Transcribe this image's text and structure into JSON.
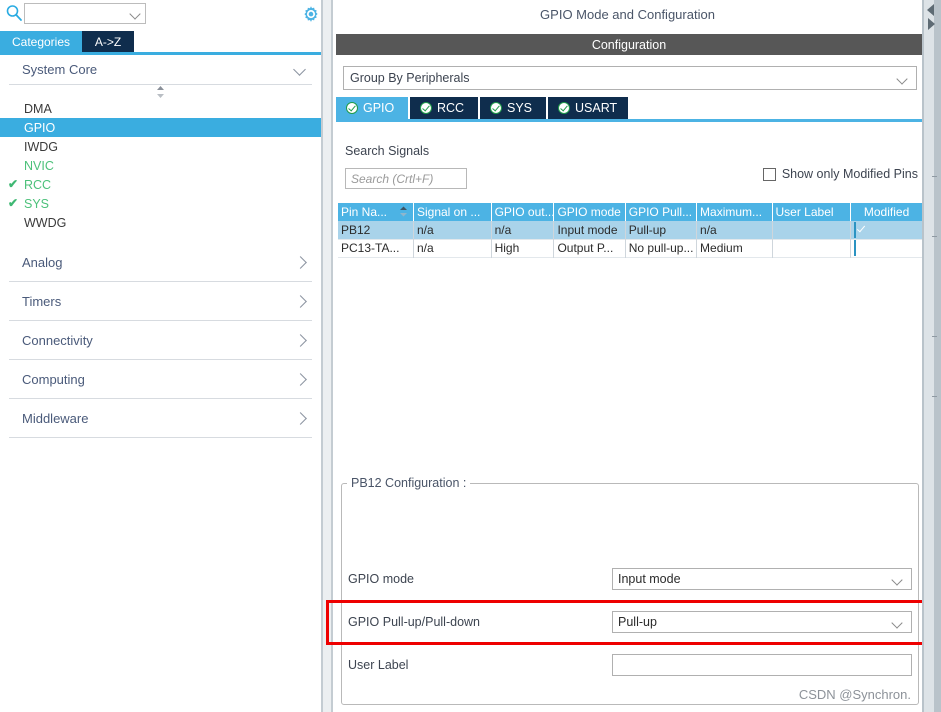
{
  "sidebar": {
    "search": {
      "value": "",
      "placeholder": "",
      "icon": "search-icon"
    },
    "gear_icon": "gear-icon",
    "tabs": [
      {
        "label": "Categories",
        "active": true
      },
      {
        "label": "A->Z",
        "active": false
      }
    ],
    "groups": [
      {
        "label": "System Core",
        "expanded": true,
        "items": [
          {
            "label": "DMA",
            "state": "normal",
            "selected": false
          },
          {
            "label": "GPIO",
            "state": "normal",
            "selected": true
          },
          {
            "label": "IWDG",
            "state": "normal",
            "selected": false
          },
          {
            "label": "NVIC",
            "state": "green",
            "selected": false
          },
          {
            "label": "RCC",
            "state": "checked",
            "selected": false
          },
          {
            "label": "SYS",
            "state": "checked",
            "selected": false
          },
          {
            "label": "WWDG",
            "state": "normal",
            "selected": false
          }
        ]
      },
      {
        "label": "Analog",
        "expanded": false,
        "items": []
      },
      {
        "label": "Timers",
        "expanded": false,
        "items": []
      },
      {
        "label": "Connectivity",
        "expanded": false,
        "items": []
      },
      {
        "label": "Computing",
        "expanded": false,
        "items": []
      },
      {
        "label": "Middleware",
        "expanded": false,
        "items": []
      }
    ]
  },
  "panel": {
    "title": "GPIO Mode and Configuration",
    "configuration_bar": "Configuration",
    "group_by": {
      "value": "Group By Peripherals"
    },
    "peripheral_tabs": [
      {
        "label": "GPIO",
        "status": "ok",
        "active": true
      },
      {
        "label": "RCC",
        "status": "ok",
        "active": false
      },
      {
        "label": "SYS",
        "status": "ok",
        "active": false
      },
      {
        "label": "USART",
        "status": "ok",
        "active": false
      }
    ],
    "search_signals_label": "Search Signals",
    "signal_search": {
      "value": "",
      "placeholder": "Search (Crtl+F)"
    },
    "show_modified": {
      "label": "Show only Modified Pins",
      "checked": false
    },
    "table": {
      "columns": [
        "Pin Na...",
        "Signal on ...",
        "GPIO out...",
        "GPIO mode",
        "GPIO Pull...",
        "Maximum...",
        "User Label",
        "Modified"
      ],
      "sort_column": 0,
      "rows": [
        {
          "selected": true,
          "cells": [
            "PB12",
            "n/a",
            "n/a",
            "Input mode",
            "Pull-up",
            "n/a",
            ""
          ],
          "modified": true
        },
        {
          "selected": false,
          "cells": [
            "PC13-TA...",
            "n/a",
            "High",
            "Output P...",
            "No pull-up...",
            "Medium",
            ""
          ],
          "modified": true
        }
      ]
    },
    "pin_config": {
      "legend": "PB12 Configuration :",
      "rows": [
        {
          "label": "GPIO mode",
          "value": "Input mode",
          "control": "dropdown"
        },
        {
          "label": "GPIO Pull-up/Pull-down",
          "value": "Pull-up",
          "control": "dropdown",
          "highlighted": true
        },
        {
          "label": "User Label",
          "value": "",
          "control": "textbox"
        }
      ]
    }
  },
  "watermark": "CSDN @Synchron.",
  "colors": {
    "accent_blue": "#3aade0",
    "tab_blue": "#4cb3e4",
    "dark_navy": "#0f2d4d",
    "header_gray": "#575757",
    "row_selected": "#a9d3ea",
    "green": "#4cc17a",
    "highlight_red": "#ee0000"
  }
}
